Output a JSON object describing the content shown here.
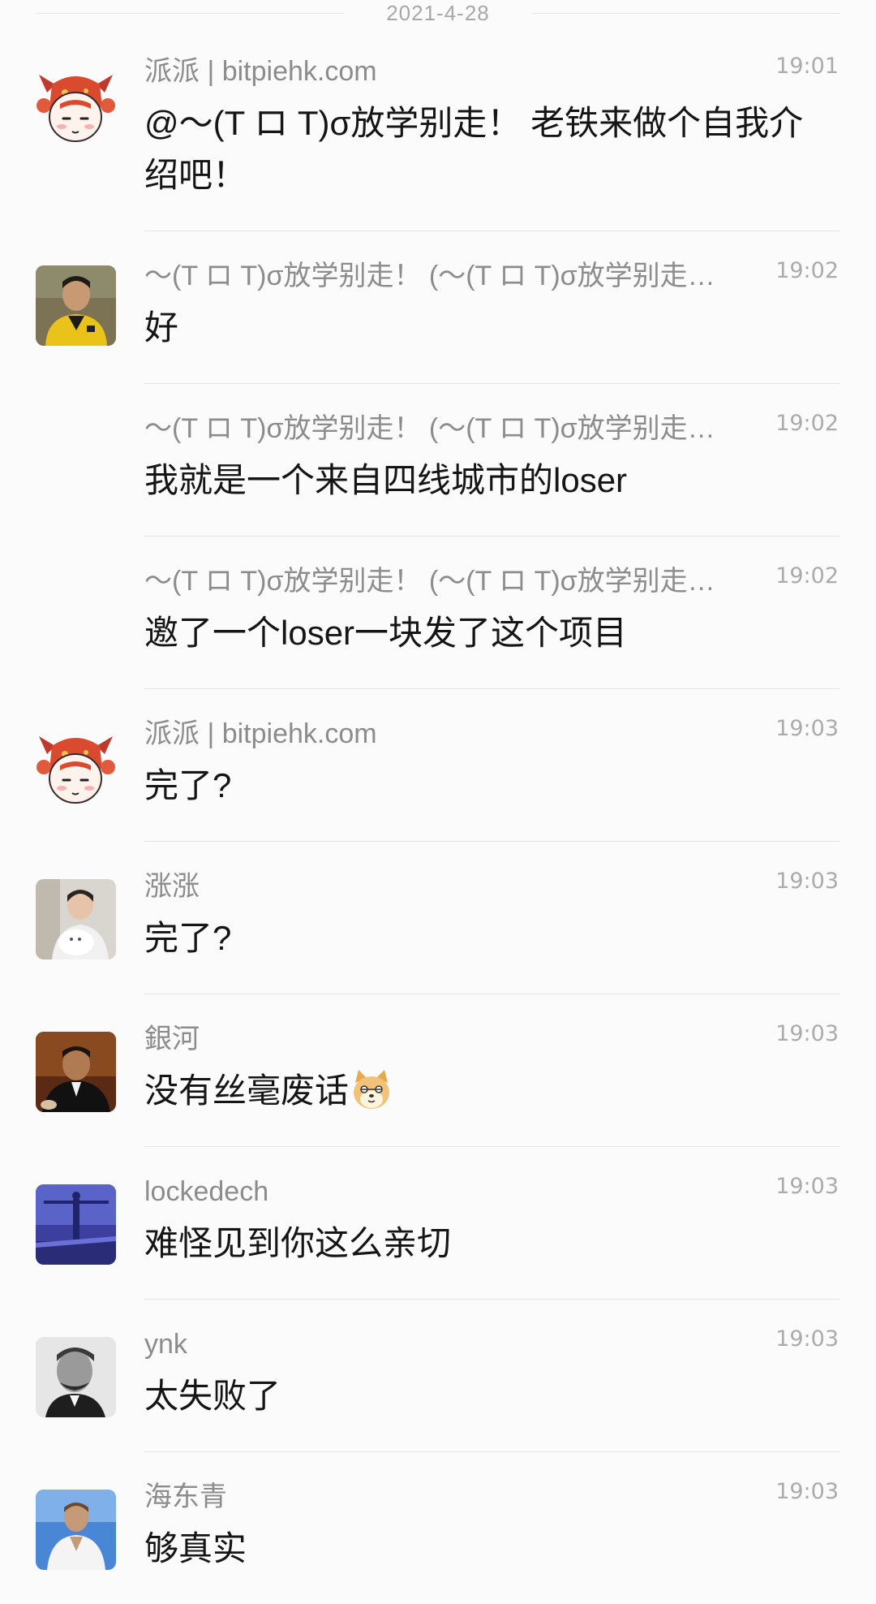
{
  "date_separator": "2021-4-28",
  "messages": [
    {
      "sender": "派派 | bitpiehk.com",
      "time": "19:01",
      "text": "@～(T ロ T)σ放学别走！ 老铁来做个自我介绍吧！",
      "avatar_icon": "cartoon-bull-avatar-icon"
    },
    {
      "sender": "～(T ロ T)σ放学别走！ (～(T ロ T)σ放学别走…",
      "time": "19:02",
      "text": "好",
      "avatar_icon": "photo-avatar-yellow-jacket"
    },
    {
      "sender": "～(T ロ T)σ放学别走！ (～(T ロ T)σ放学别走…",
      "time": "19:02",
      "text": "我就是一个来自四线城市的loser"
    },
    {
      "sender": "～(T ロ T)σ放学别走！ (～(T ロ T)σ放学别走…",
      "time": "19:02",
      "text": "邀了一个loser一块发了这个项目"
    },
    {
      "sender": "派派 | bitpiehk.com",
      "time": "19:03",
      "text": "完了?",
      "avatar_icon": "cartoon-bull-avatar-icon"
    },
    {
      "sender": "涨涨",
      "time": "19:03",
      "text": "完了?",
      "avatar_icon": "photo-avatar-child-with-cat"
    },
    {
      "sender": "銀河",
      "time": "19:03",
      "text": "没有丝毫废话",
      "emoji": "doge-emoji-icon",
      "avatar_icon": "photo-avatar-godfather"
    },
    {
      "sender": "lockedech",
      "time": "19:03",
      "text": "难怪见到你这么亲切",
      "avatar_icon": "photo-avatar-statue-blue"
    },
    {
      "sender": "ynk",
      "time": "19:03",
      "text": "太失败了",
      "avatar_icon": "photo-avatar-bw-portrait"
    },
    {
      "sender": "海东青",
      "time": "19:03",
      "text": "够真实",
      "avatar_icon": "photo-avatar-man-sky"
    }
  ],
  "colors": {
    "background": "#fbfbfb",
    "sender_text": "#8c8c8c",
    "message_text": "#151515",
    "time_text": "#ababab",
    "divider": "#e4e4e4"
  }
}
